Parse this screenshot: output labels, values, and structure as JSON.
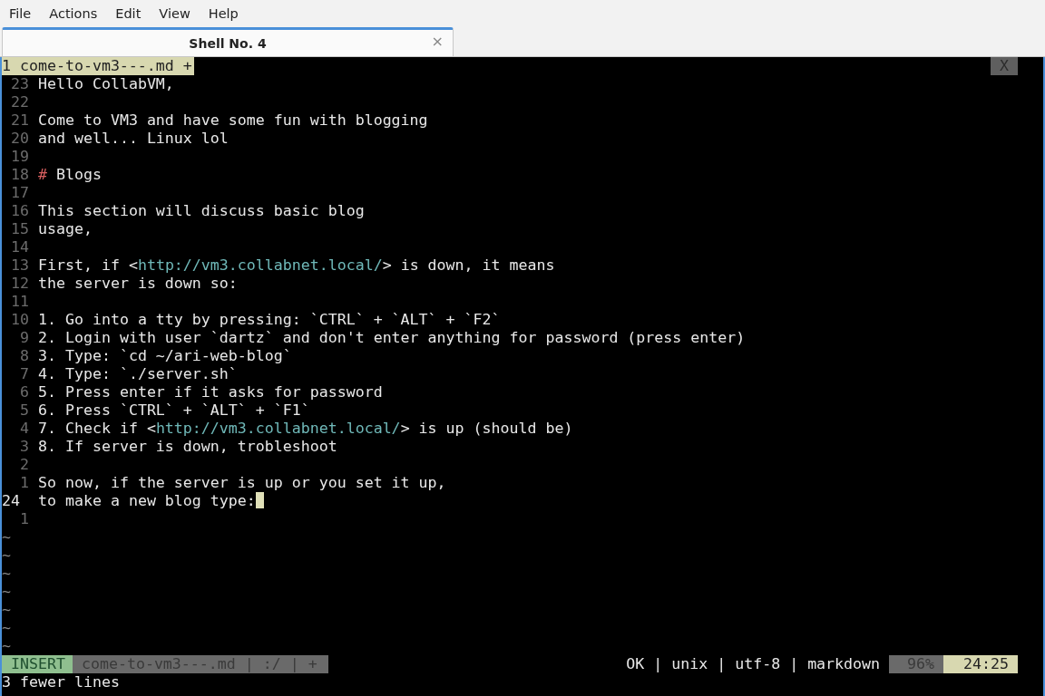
{
  "menu": [
    "File",
    "Actions",
    "Edit",
    "View",
    "Help"
  ],
  "tabs": [
    {
      "label": "Shell No. 4",
      "close": "×",
      "selected": true
    }
  ],
  "vim": {
    "tabline": {
      "buffer": "1 come-to-vm3---.md +",
      "close": "X"
    },
    "lines": [
      {
        "number": "23",
        "current": false,
        "segments": [
          {
            "kind": "text",
            "text": "Hello CollabVM,"
          }
        ]
      },
      {
        "number": "22",
        "current": false
      },
      {
        "number": "21",
        "current": false,
        "segments": [
          {
            "kind": "text",
            "text": "Come to VM3 and have some fun with blogging"
          }
        ]
      },
      {
        "number": "20",
        "current": false,
        "segments": [
          {
            "kind": "text",
            "text": "and well... Linux lol"
          }
        ]
      },
      {
        "number": "19",
        "current": false
      },
      {
        "number": "18",
        "current": false,
        "segments": [
          {
            "kind": "heading",
            "text": "#"
          },
          {
            "kind": "text",
            "text": " Blogs"
          }
        ]
      },
      {
        "number": "17",
        "current": false
      },
      {
        "number": "16",
        "current": false,
        "segments": [
          {
            "kind": "text",
            "text": "This section will discuss basic blog"
          }
        ]
      },
      {
        "number": "15",
        "current": false,
        "segments": [
          {
            "kind": "text",
            "text": "usage,"
          }
        ]
      },
      {
        "number": "14",
        "current": false
      },
      {
        "number": "13",
        "current": false,
        "segments": [
          {
            "kind": "text",
            "text": "First, if <"
          },
          {
            "kind": "url",
            "text": "http://vm3.collabnet.local/"
          },
          {
            "kind": "text",
            "text": "> is down, it means"
          }
        ]
      },
      {
        "number": "12",
        "current": false,
        "segments": [
          {
            "kind": "text",
            "text": "the server is down so:"
          }
        ]
      },
      {
        "number": "11",
        "current": false
      },
      {
        "number": "10",
        "current": false,
        "segments": [
          {
            "kind": "text",
            "text": "1. Go into a tty by pressing: `CTRL` + `ALT` + `F2`"
          }
        ]
      },
      {
        "number": "9",
        "current": false,
        "segments": [
          {
            "kind": "text",
            "text": "2. Login with user `dartz` and don't enter anything for password (press enter)"
          }
        ]
      },
      {
        "number": "8",
        "current": false,
        "segments": [
          {
            "kind": "text",
            "text": "3. Type: `cd ~/ari-web-blog`"
          }
        ]
      },
      {
        "number": "7",
        "current": false,
        "segments": [
          {
            "kind": "text",
            "text": "4. Type: `./server.sh`"
          }
        ]
      },
      {
        "number": "6",
        "current": false,
        "segments": [
          {
            "kind": "text",
            "text": "5. Press enter if it asks for password"
          }
        ]
      },
      {
        "number": "5",
        "current": false,
        "segments": [
          {
            "kind": "text",
            "text": "6. Press `CTRL` + `ALT` + `F1`"
          }
        ]
      },
      {
        "number": "4",
        "current": false,
        "segments": [
          {
            "kind": "text",
            "text": "7. Check if <"
          },
          {
            "kind": "url",
            "text": "http://vm3.collabnet.local/"
          },
          {
            "kind": "text",
            "text": "> is up (should be)"
          }
        ]
      },
      {
        "number": "3",
        "current": false,
        "segments": [
          {
            "kind": "text",
            "text": "8. If server is down, trobleshoot"
          }
        ]
      },
      {
        "number": "2",
        "current": false
      },
      {
        "number": "1",
        "current": false,
        "segments": [
          {
            "kind": "text",
            "text": "So now, if the server is up or you set it up,"
          }
        ]
      },
      {
        "number": "24",
        "current": true,
        "cursor": true,
        "segments": [
          {
            "kind": "text",
            "text": "to make a new blog type:"
          }
        ]
      },
      {
        "number": "1",
        "current": false
      }
    ],
    "tildes": [
      "~",
      "~",
      "~",
      "~",
      "~",
      "~",
      "~"
    ],
    "status": {
      "mode": "INSERT",
      "file": "come-to-vm3---.md | :/ | +",
      "info": "OK | unix | utf-8 | markdown",
      "percent": "96%",
      "position": "24:25"
    },
    "message": "3 fewer lines"
  }
}
